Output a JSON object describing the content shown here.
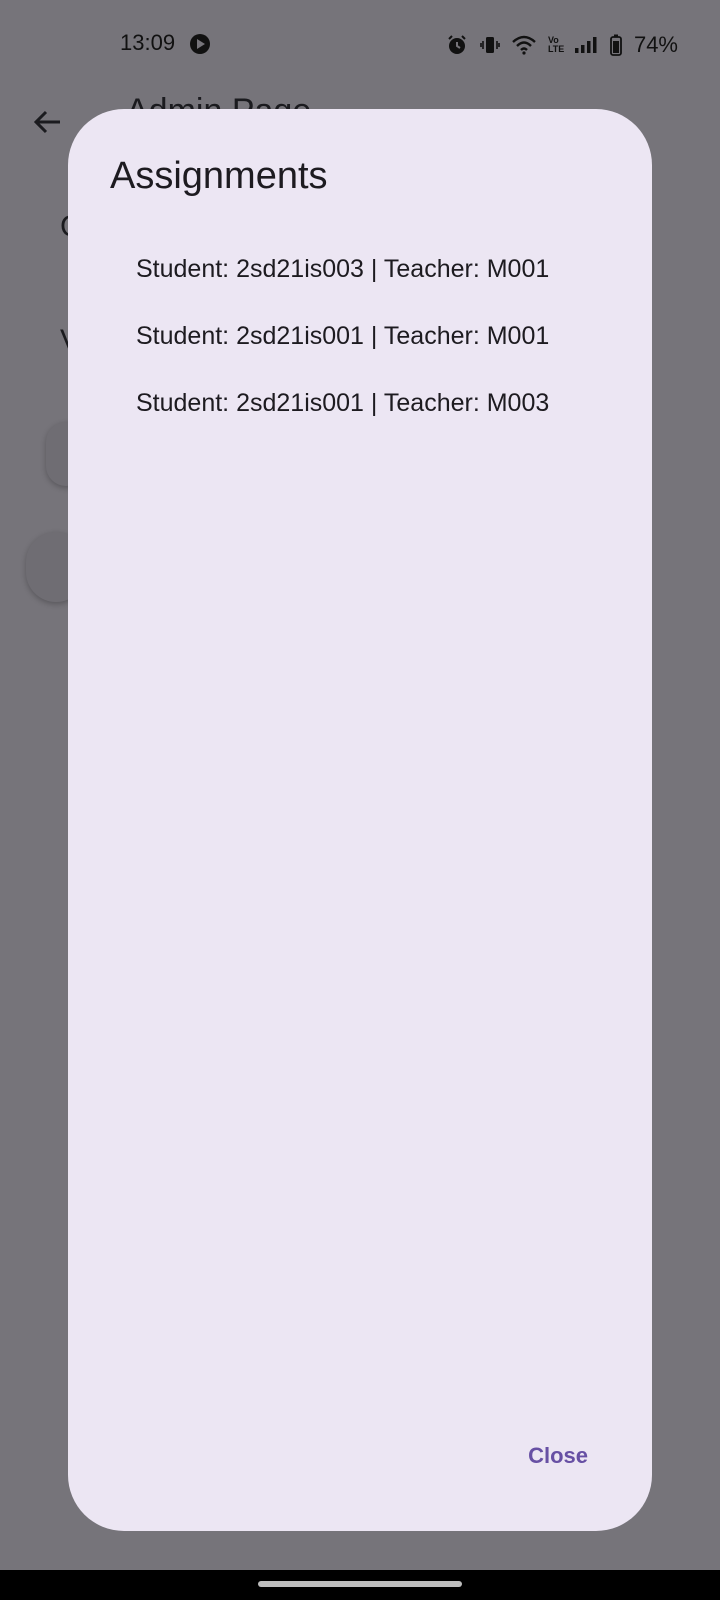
{
  "status_bar": {
    "time": "13:09",
    "battery": "74%",
    "network_label": "Vo LTE"
  },
  "background": {
    "title": "Admin Page",
    "letter_1": "C",
    "letter_2": "V"
  },
  "dialog": {
    "title": "Assignments",
    "assignments": [
      "Student: 2sd21is003 | Teacher: M001",
      "Student: 2sd21is001 | Teacher: M001",
      "Student: 2sd21is001 | Teacher: M003"
    ],
    "close_label": "Close"
  },
  "colors": {
    "scrim": "#76747a",
    "dialog_bg": "#ece6f3",
    "accent": "#6750a4"
  }
}
